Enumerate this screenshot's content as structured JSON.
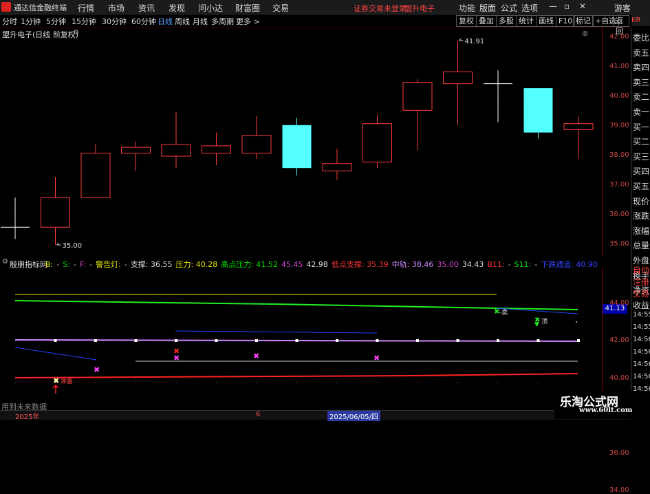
{
  "title_bar": {
    "app_name": "通达信金融终端",
    "menus": [
      "行情",
      "市场",
      "资讯",
      "发现",
      "问小达",
      "财富圈",
      "交易"
    ],
    "warning": "证券交易未登录",
    "stock_name": "盟升电子",
    "right_menus": [
      "功能",
      "版面",
      "公式",
      "选项"
    ],
    "user": "游客"
  },
  "period_bar": {
    "periods": [
      "分时",
      "1分钟",
      "5分钟",
      "15分钟",
      "30分钟",
      "60分钟",
      "日线",
      "周线",
      "月线",
      "多周期",
      "更多 >"
    ],
    "active": "日线",
    "tools": [
      "复权",
      "叠加",
      "多股",
      "统计",
      "画线",
      "F10",
      "标记",
      "+自选",
      "返回"
    ]
  },
  "main_chart": {
    "title": "盟升电子(日线 前复权)",
    "high_label": "41.91",
    "low_label": "35.00",
    "y_ticks": [
      "42.00",
      "41.00",
      "40.00",
      "39.00",
      "38.00",
      "37.00",
      "36.00",
      "35.00"
    ],
    "candles": [
      {
        "o": 35.6,
        "c": 35.6,
        "h": 36.6,
        "l": 35.2
      },
      {
        "o": 35.6,
        "c": 36.6,
        "h": 37.3,
        "l": 35.0
      },
      {
        "o": 36.6,
        "c": 38.1,
        "h": 38.4,
        "l": 36.6
      },
      {
        "o": 38.1,
        "c": 38.3,
        "h": 38.5,
        "l": 37.5
      },
      {
        "o": 38.0,
        "c": 38.4,
        "h": 39.5,
        "l": 37.6
      },
      {
        "o": 38.1,
        "c": 38.35,
        "h": 38.8,
        "l": 37.7
      },
      {
        "o": 38.1,
        "c": 38.7,
        "h": 39.35,
        "l": 37.9
      },
      {
        "o": 39.05,
        "c": 37.6,
        "h": 39.3,
        "l": 37.35
      },
      {
        "o": 37.5,
        "c": 37.75,
        "h": 38.25,
        "l": 37.2
      },
      {
        "o": 37.8,
        "c": 39.1,
        "h": 39.4,
        "l": 37.6
      },
      {
        "o": 39.55,
        "c": 40.5,
        "h": 40.6,
        "l": 38.2
      },
      {
        "o": 40.45,
        "c": 40.85,
        "h": 41.91,
        "l": 39.05
      },
      {
        "o": 40.45,
        "c": 40.45,
        "h": 40.9,
        "l": 39.15
      },
      {
        "o": 40.3,
        "c": 38.8,
        "h": 40.3,
        "l": 38.6
      },
      {
        "o": 38.9,
        "c": 39.1,
        "h": 39.35,
        "l": 37.9
      }
    ]
  },
  "indicator": {
    "name": "殷朋指标网",
    "legend": [
      {
        "text": "B:",
        "color": "#e8e800"
      },
      {
        "text": "-",
        "color": "#ccc"
      },
      {
        "text": "S:",
        "color": "#00cc00"
      },
      {
        "text": "-",
        "color": "#ccc"
      },
      {
        "text": "F:",
        "color": "#cc44cc"
      },
      {
        "text": "-",
        "color": "#ccc"
      },
      {
        "text": "警告灯:",
        "color": "#e8e800"
      },
      {
        "text": "-",
        "color": "#ccc"
      },
      {
        "text": "支撑: 36.55",
        "color": "#ddd"
      },
      {
        "text": "压力: 40.28",
        "color": "#e8e800"
      },
      {
        "text": "高点压力: 41.52",
        "color": "#00e000"
      },
      {
        "text": "45.45",
        "color": "#cc44cc"
      },
      {
        "text": "42.98",
        "color": "#ddd"
      },
      {
        "text": "低点支撑: 35.39",
        "color": "#ff3333"
      },
      {
        "text": "中轨: 38.46",
        "color": "#cc88ff"
      },
      {
        "text": "35.00",
        "color": "#cc44cc"
      },
      {
        "text": "34.43",
        "color": "#ddd"
      },
      {
        "text": "B11:",
        "color": "#ff3333"
      },
      {
        "text": "-",
        "color": "#ccc"
      },
      {
        "text": "S11:",
        "color": "#00e000"
      },
      {
        "text": "-",
        "color": "#ccc"
      },
      {
        "text": "下跌通道: 40.90",
        "color": "#3344ff"
      }
    ],
    "y_ticks": [
      "44.00",
      "42.00",
      "40.00",
      "38.00",
      "36.00",
      "34.00"
    ],
    "current_value": "41.13",
    "sell_label": "-卖",
    "top_label": "顶",
    "buy_label": "准备"
  },
  "sidebar": {
    "top_badge": "KR",
    "items": [
      "委比",
      "卖五",
      "卖四",
      "卖三",
      "卖二",
      "卖一",
      "买一",
      "买二",
      "买三",
      "买四",
      "买五",
      "现价",
      "涨跌",
      "涨幅",
      "总量",
      "外盘",
      "换手",
      "净资",
      "收益",
      "自动",
      "注册",
      "交易"
    ],
    "times": [
      "14:55",
      "14:55",
      "14:56",
      "14:56",
      "14:56",
      "14:56",
      "14:56"
    ]
  },
  "bottom_bar": {
    "note": "用到未来数据",
    "year": "2025年",
    "month": "6",
    "cursor_date": "2025/06/05/四",
    "watermark": "乐淘公式网",
    "watermark_url": "www.60lt.com"
  }
}
